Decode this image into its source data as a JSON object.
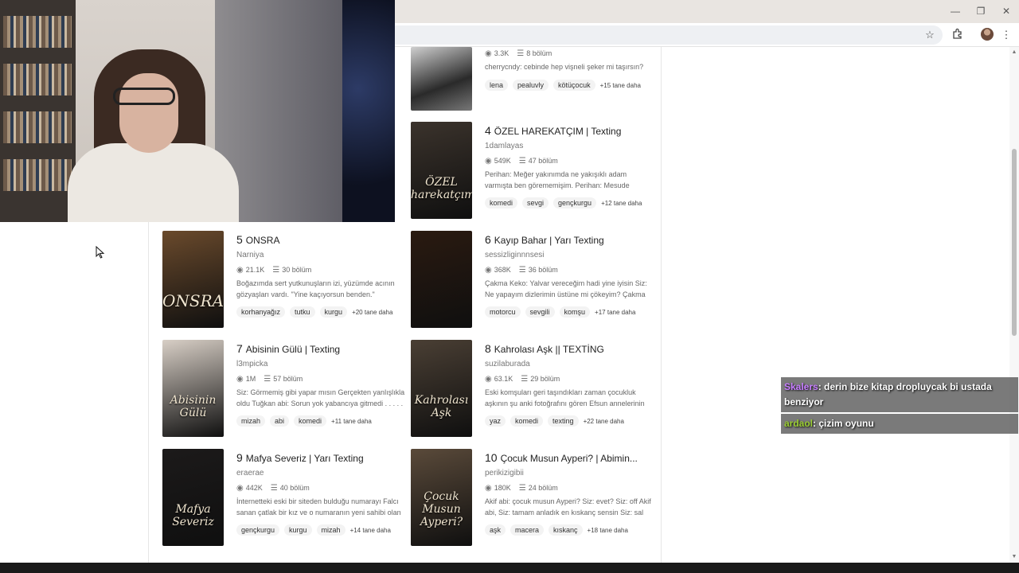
{
  "browser": {
    "window_controls": {
      "minimize": "—",
      "restore": "❐",
      "close": "✕"
    },
    "icons": [
      "star-icon",
      "extensions-icon",
      "profile-avatar",
      "menu-icon"
    ]
  },
  "stories_top": [
    {
      "views": "3.3K",
      "chapters": "8 bölüm",
      "desc": "cherrycndy: cebinde hep vişneli şeker mi taşırsın?",
      "tags": [
        "lena",
        "pealuvly",
        "kötüçocuk"
      ],
      "more": "+15 tane daha"
    }
  ],
  "stories": [
    {
      "rank": "4",
      "title": "ÖZEL HAREKATÇIM | Texting",
      "author": "1damlayas",
      "views": "549K",
      "chapters": "47 bölüm",
      "desc": "Perihan: Meğer yakınımda ne yakışıklı adam varmışta ben görememişim. Perihan: Mesude teyzenin rahmine sağlık. Sancak Abi: ? Sancak A...",
      "tags": [
        "komedi",
        "sevgi",
        "gençkurgu"
      ],
      "more": "+12 tane daha",
      "cover_text": "ÖZEL harekatçım",
      "color": "#3b332c"
    },
    {
      "rank": "5",
      "title": "ONSRA",
      "author": "Narniya",
      "views": "21.1K",
      "chapters": "30 bölüm",
      "desc": "Boğazımda sert yutkunuşların izi, yüzümde acının gözyaşları vardı. \"Yine kaçıyorsun benden.\" dediğinde adımlarımı duraksadı, sesindeki...",
      "tags": [
        "korhanyağız",
        "tutku",
        "kurgu"
      ],
      "more": "+20 tane daha",
      "cover_text": "ONSRA",
      "color": "#6a4a2c"
    },
    {
      "rank": "6",
      "title": "Kayıp Bahar | Yarı Texting",
      "author": "sessizliginnnsesi",
      "views": "368K",
      "chapters": "36 bölüm",
      "desc": "Çakma Keko: Yalvar vereceğim hadi yine iyisin Siz: Ne yapayım dizlerimin üstüne mi çökeyim? Çakma Keko: Çok Siz: Neler geçiyor aklımdan..(...",
      "tags": [
        "motorcu",
        "sevgili",
        "komşu"
      ],
      "more": "+17 tane daha",
      "cover_text": "",
      "color": "#2a1a10"
    },
    {
      "rank": "7",
      "title": "Abisinin Gülü | Texting",
      "author": "l3mpicka",
      "views": "1M",
      "chapters": "57 bölüm",
      "desc": "Siz: Görmemiş gibi yapar mısın Gerçekten yanlışlıkla oldu Tuğkan abi: Sorun yok yabancıya gitmedi . . . . . *Küfür, argo, cinsellik içerir!",
      "tags": [
        "mizah",
        "abi",
        "komedi"
      ],
      "more": "+11 tane daha",
      "cover_text": "Abisinin Gülü",
      "color": "#d8cfc6"
    },
    {
      "rank": "8",
      "title": "Kahrolası Aşk || TEXTİNG",
      "author": "suzilaburada",
      "views": "63.1K",
      "chapters": "29 bölüm",
      "desc": "Eski komşuları geri taşındıkları zaman çocukluk aşkının şu anki fotoğrafını gören Efsun annelerinin baskısıyla çocukluk arkadaşına mes...",
      "tags": [
        "yaz",
        "komedi",
        "texting"
      ],
      "more": "+22 tane daha",
      "cover_text": "Kahrolası Aşk",
      "color": "#4a3f34"
    },
    {
      "rank": "9",
      "title": "Mafya Severiz | Yarı Texting",
      "author": "eraerae",
      "views": "442K",
      "chapters": "40 bölüm",
      "desc": "İnternetteki eski bir siteden bulduğu numarayı Falcı sanan çatlak bir kız ve o numaranın yeni sahibi olan acımasız bir mafya lideri: Sarp Atasoy. Yera...",
      "tags": [
        "gençkurgu",
        "kurgu",
        "mizah"
      ],
      "more": "+14 tane daha",
      "cover_text": "Mafya Severiz",
      "color": "#1c1a1a"
    },
    {
      "rank": "10",
      "title": "Çocuk Musun Ayperi? | Abimin...",
      "author": "perikizigibii",
      "views": "180K",
      "chapters": "24 bölüm",
      "desc": "Akif abi: çocuk musun Ayperi? Siz: evet? Siz: off Akif abi, Siz: tamam anladık en kıskanç sensin Siz: sal artık beni ve çevremdeki erkekleri",
      "tags": [
        "aşk",
        "macera",
        "kıskanç"
      ],
      "more": "+18 tane daha",
      "cover_text": "Çocuk Musun Ayperi?",
      "color": "#5a4a3a"
    }
  ],
  "chat": [
    {
      "user": "Skalers",
      "user_color": "#c77dff",
      "text": ": derin bize kitap dropluycak bi ustada benziyor"
    },
    {
      "user": "ardaol",
      "user_color": "#9acd32",
      "text": ": çizim oyunu"
    }
  ]
}
